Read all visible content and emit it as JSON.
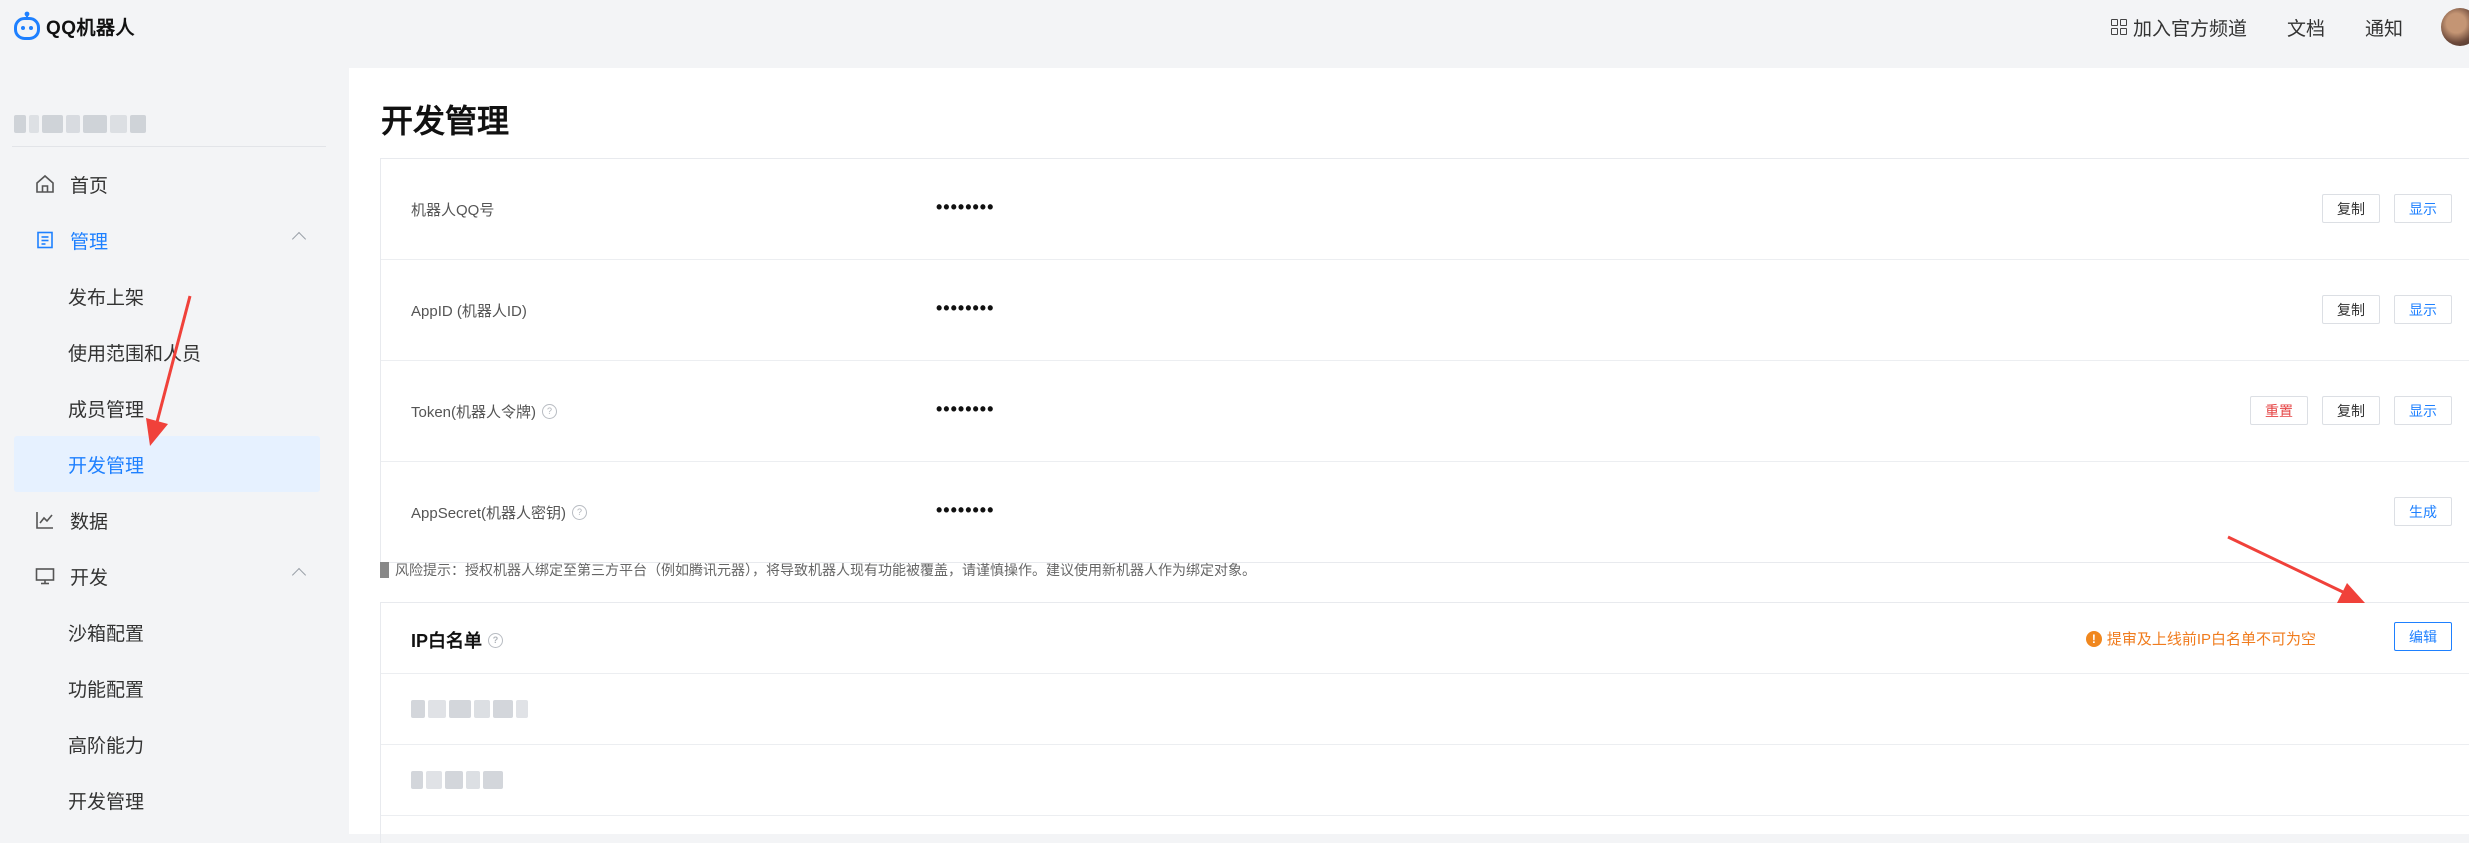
{
  "app": {
    "name": "QQ机器人"
  },
  "topnav": {
    "channel": "加入官方频道",
    "docs": "文档",
    "notify": "通知"
  },
  "sidebar": {
    "items": [
      {
        "label": "首页",
        "icon": "home-icon"
      },
      {
        "label": "管理",
        "icon": "manage-icon",
        "expanded": true
      },
      {
        "label": "发布上架"
      },
      {
        "label": "使用范围和人员"
      },
      {
        "label": "成员管理"
      },
      {
        "label": "开发管理",
        "selected": true
      },
      {
        "label": "数据",
        "icon": "chart-icon"
      },
      {
        "label": "开发",
        "icon": "monitor-icon",
        "expanded": true
      },
      {
        "label": "沙箱配置"
      },
      {
        "label": "功能配置"
      },
      {
        "label": "高阶能力"
      },
      {
        "label": "开发管理"
      }
    ]
  },
  "main": {
    "title": "开发管理",
    "credentials": [
      {
        "label": "机器人QQ号",
        "value": "••••••••",
        "help": false,
        "buttons": [
          "复制",
          "显示"
        ]
      },
      {
        "label": "AppID (机器人ID)",
        "value": "••••••••",
        "help": false,
        "buttons": [
          "复制",
          "显示"
        ]
      },
      {
        "label": "Token(机器人令牌)",
        "value": "••••••••",
        "help": true,
        "buttons": [
          "重置",
          "复制",
          "显示"
        ]
      },
      {
        "label": "AppSecret(机器人密钥)",
        "value": "••••••••",
        "help": true,
        "buttons": [
          "生成"
        ]
      }
    ],
    "risk_tip": "风险提示：授权机器人绑定至第三方平台（例如腾讯元器），将导致机器人现有功能被覆盖，请谨慎操作。建议使用新机器人作为绑定对象。",
    "ip_whitelist": {
      "title": "IP白名单",
      "warning": "提审及上线前IP白名单不可为空",
      "edit_label": "编辑"
    }
  },
  "colors": {
    "accent": "#1e80ff",
    "warning": "#f07c1e",
    "danger": "#e54545",
    "annotation": "#f0413a"
  }
}
